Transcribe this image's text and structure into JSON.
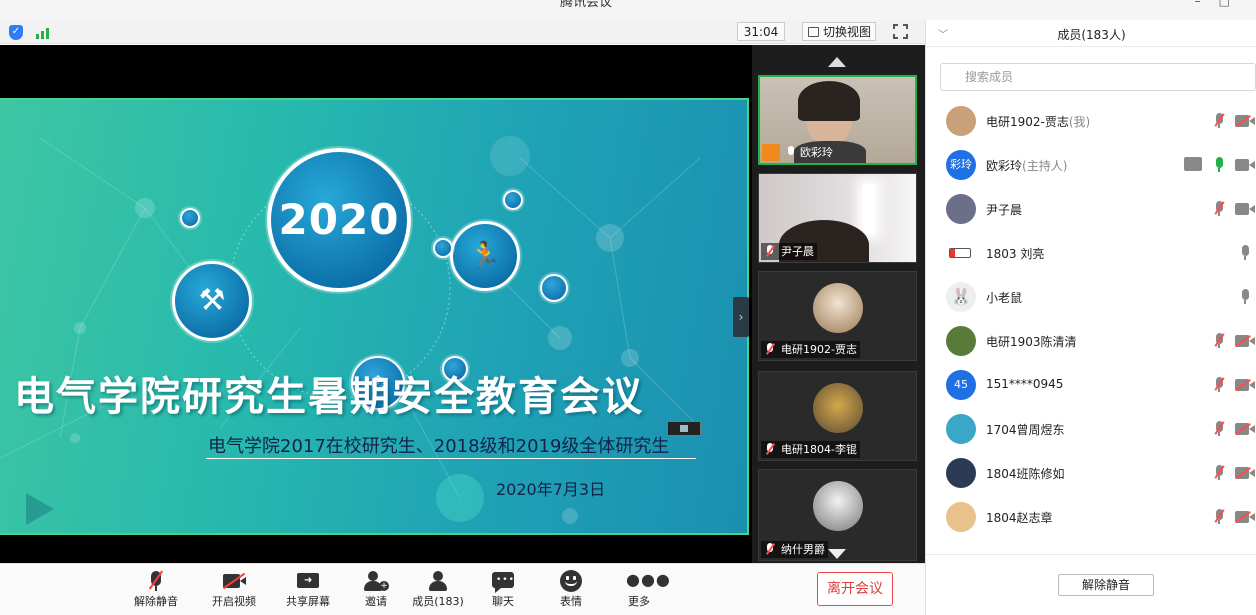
{
  "window": {
    "title": "腾讯会议"
  },
  "topbar": {
    "timer": "31:04",
    "switch_view": "切换视图"
  },
  "slide": {
    "year": "2020",
    "title": "电气学院研究生暑期安全教育会议",
    "subtitle": "电气学院2017在校研究生、2018级和2019级全体研究生",
    "date": "2020年7月3日"
  },
  "thumbnails": [
    {
      "name": "欧彩玲",
      "active": true
    },
    {
      "name": "尹子晨",
      "active": false
    },
    {
      "name": "电研1902-贾志",
      "active": false
    },
    {
      "name": "电研1804-李锟",
      "active": false
    },
    {
      "name": "纳什男爵",
      "active": false
    }
  ],
  "toolbar": {
    "mute": "解除静音",
    "video": "开启视频",
    "share": "共享屏幕",
    "invite": "邀请",
    "members": "成员(183)",
    "chat": "聊天",
    "emoji": "表情",
    "more": "更多",
    "leave": "离开会议"
  },
  "panel": {
    "title": "成员(183人)",
    "search_placeholder": "搜索成员",
    "unmute_all": "解除静音",
    "members": [
      {
        "name": "电研1902-贾志",
        "role": "(我)",
        "avatar_text": "",
        "avatar_color": "#c9a07a"
      },
      {
        "name": "欧彩玲",
        "role": "(主持人)",
        "avatar_text": "彩玲",
        "avatar_color": "#1f6fe5"
      },
      {
        "name": "尹子晨",
        "role": "",
        "avatar_text": "",
        "avatar_color": "#6b6f8a"
      },
      {
        "name": "1803 刘亮",
        "role": "",
        "avatar_text": "",
        "avatar_color": "#ffffff"
      },
      {
        "name": "小老鼠",
        "role": "",
        "avatar_text": "",
        "avatar_color": "#eeeeee"
      },
      {
        "name": "电研1903陈清清",
        "role": "",
        "avatar_text": "",
        "avatar_color": "#5a7a3a"
      },
      {
        "name": "151****0945",
        "role": "",
        "avatar_text": "45",
        "avatar_color": "#1f6fe5"
      },
      {
        "name": "1704曾周煜东",
        "role": "",
        "avatar_text": "",
        "avatar_color": "#3aa6c8"
      },
      {
        "name": "1804班陈修如",
        "role": "",
        "avatar_text": "",
        "avatar_color": "#2b3a55"
      },
      {
        "name": "1804赵志章",
        "role": "",
        "avatar_text": "",
        "avatar_color": "#e8c28a"
      }
    ]
  },
  "icons": {
    "security": "shield-icon",
    "network": "signal-icon",
    "fullscreen": "fullscreen-icon",
    "mute": "mic-off-icon",
    "video": "camera-off-icon",
    "share": "share-screen-icon",
    "invite": "invite-user-icon",
    "members": "members-icon",
    "chat": "chat-icon",
    "emoji": "emoji-icon",
    "more": "more-icon"
  },
  "colors": {
    "accent": "#1f6fe5",
    "active_green": "#21b24b",
    "danger": "#e23c3c"
  }
}
